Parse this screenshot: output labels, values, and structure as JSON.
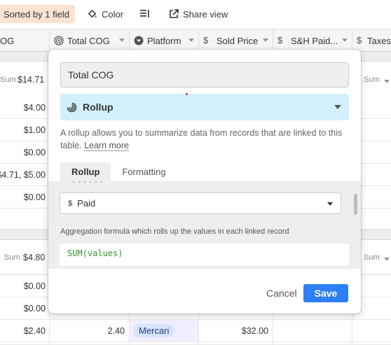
{
  "toolbar": {
    "sorted_label": "Sorted by 1 field",
    "color_label": "Color",
    "rowheight_icon": "row-height-icon",
    "share_label": "Share view"
  },
  "columns": [
    {
      "label": "OG",
      "icon": ""
    },
    {
      "label": "Total COG",
      "icon": "rollup-icon"
    },
    {
      "label": "Platform",
      "icon": "single-select-icon"
    },
    {
      "label": "Sold Price",
      "icon": "currency-icon"
    },
    {
      "label": "S&H Paid...",
      "icon": "currency-icon"
    },
    {
      "label": "Taxes",
      "icon": "currency-icon"
    }
  ],
  "group1": {
    "sum_label": "Sum",
    "sum_value": "$14.71",
    "right_sum_label": "Sum",
    "rows": [
      "$4.00",
      "$1.00",
      "$0.00",
      "$4.71, $5.00",
      "$0.00"
    ]
  },
  "group2": {
    "sum_label": "Sum",
    "sum_value": "$4.80",
    "right_sum_label": "Sum",
    "rows": [
      "$0.00",
      "$0.00",
      "$2.40"
    ],
    "last_row": {
      "total_cog": "2.40",
      "platform": "Mercari",
      "sold_price": "$32.00"
    }
  },
  "modal": {
    "field_name": "Total COG",
    "type_label": "Rollup",
    "description": "A rollup allows you to summarize data from records that are linked to this table.",
    "learn_more": "Learn more",
    "tabs": [
      "Rollup",
      "Formatting"
    ],
    "cut_text": "· · · · · ·",
    "field_select_icon": "$",
    "field_select_value": "Paid",
    "aggregation_label": "Aggregation formula which rolls up the values in each linked record",
    "formula": "SUM(values)",
    "cancel_label": "Cancel",
    "save_label": "Save"
  },
  "colors": {
    "accent": "#2d7ff9",
    "rollup_bg": "#d1f0fb",
    "sorted_bg": "#fbe3d2",
    "chip_bg": "#d7e4ff",
    "formula_text": "#2e9a2e"
  }
}
